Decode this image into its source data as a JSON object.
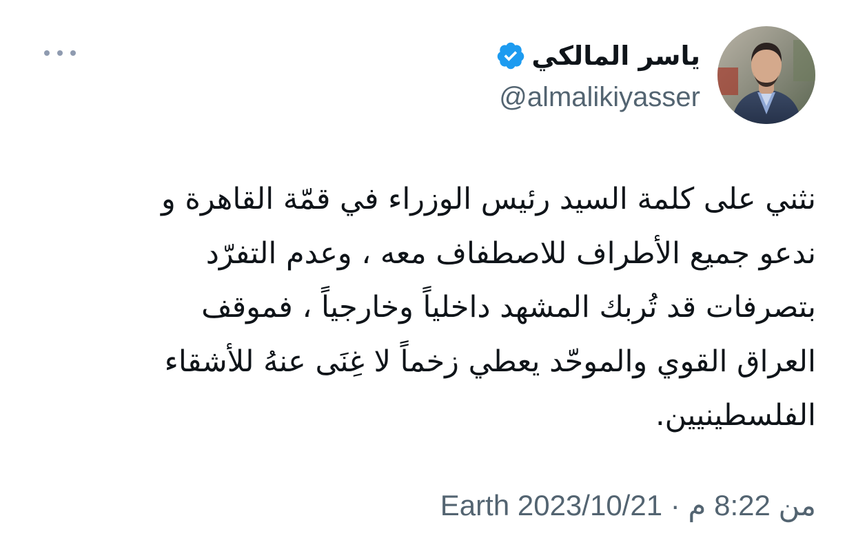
{
  "tweet": {
    "author": {
      "display_name": "ياسر المالكي",
      "handle": "@almalikiyasser",
      "verified": true,
      "verified_color": "#1d9bf0"
    },
    "more_icon": "more-horizontal-icon",
    "text_lines": [
      "نثني على كلمة السيد رئيس الوزراء في قمّة القاهرة و",
      "ندعو جميع الأطراف للاصطفاف معه ، وعدم التفرّد",
      "بتصرفات قد تُربك المشهد داخلياً وخارجياً ، فموقف",
      "العراق القوي والموحّد يعطي زخماً لا غِنَى عنهُ للأشقاء",
      "الفلسطينيين."
    ],
    "meta": {
      "source": "Earth",
      "from": "من",
      "time": "8:22 م",
      "separator": "·",
      "date": "2023/10/21"
    }
  },
  "colors": {
    "text_primary": "#0f1419",
    "text_secondary": "#536471",
    "background": "#ffffff"
  }
}
